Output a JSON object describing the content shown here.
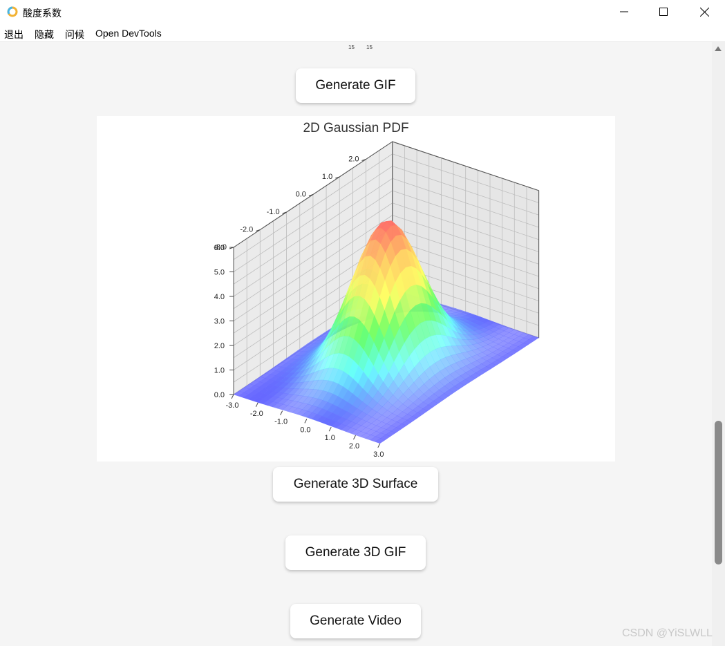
{
  "window": {
    "title": "酸度系数",
    "controls": {
      "minimize_icon": "minimize-icon",
      "maximize_icon": "maximize-icon",
      "close_icon": "close-icon"
    }
  },
  "menu": [
    "退出",
    "隐藏",
    "问候",
    "Open DevTools"
  ],
  "top_labels": [
    "15",
    "15"
  ],
  "buttons": {
    "generate_gif": "Generate GIF",
    "generate_3d_surface": "Generate 3D Surface",
    "generate_3d_gif": "Generate 3D GIF",
    "generate_video": "Generate Video"
  },
  "chart_data": {
    "type": "surface",
    "title": "2D Gaussian PDF",
    "x_ticks": [
      "-3.0",
      "-2.0",
      "-1.0",
      "0.0",
      "1.0",
      "2.0",
      "3.0"
    ],
    "y_ticks": [
      "-3.0",
      "-2.0",
      "-1.0",
      "0.0",
      "1.0",
      "2.0"
    ],
    "z_ticks": [
      "0.0",
      "1.0",
      "2.0",
      "3.0",
      "4.0",
      "5.0",
      "6.0"
    ],
    "z_top_overlap_label": "8.0",
    "xlim": [
      -3,
      3
    ],
    "ylim": [
      -3,
      3
    ],
    "zlim": [
      0,
      6
    ],
    "peak": 5.9,
    "grid": true,
    "colormap": [
      "#6666ff",
      "#66ffff",
      "#66ff66",
      "#ffff66",
      "#ffcc66",
      "#ff6666"
    ]
  },
  "watermark": "CSDN @YiSLWLL"
}
